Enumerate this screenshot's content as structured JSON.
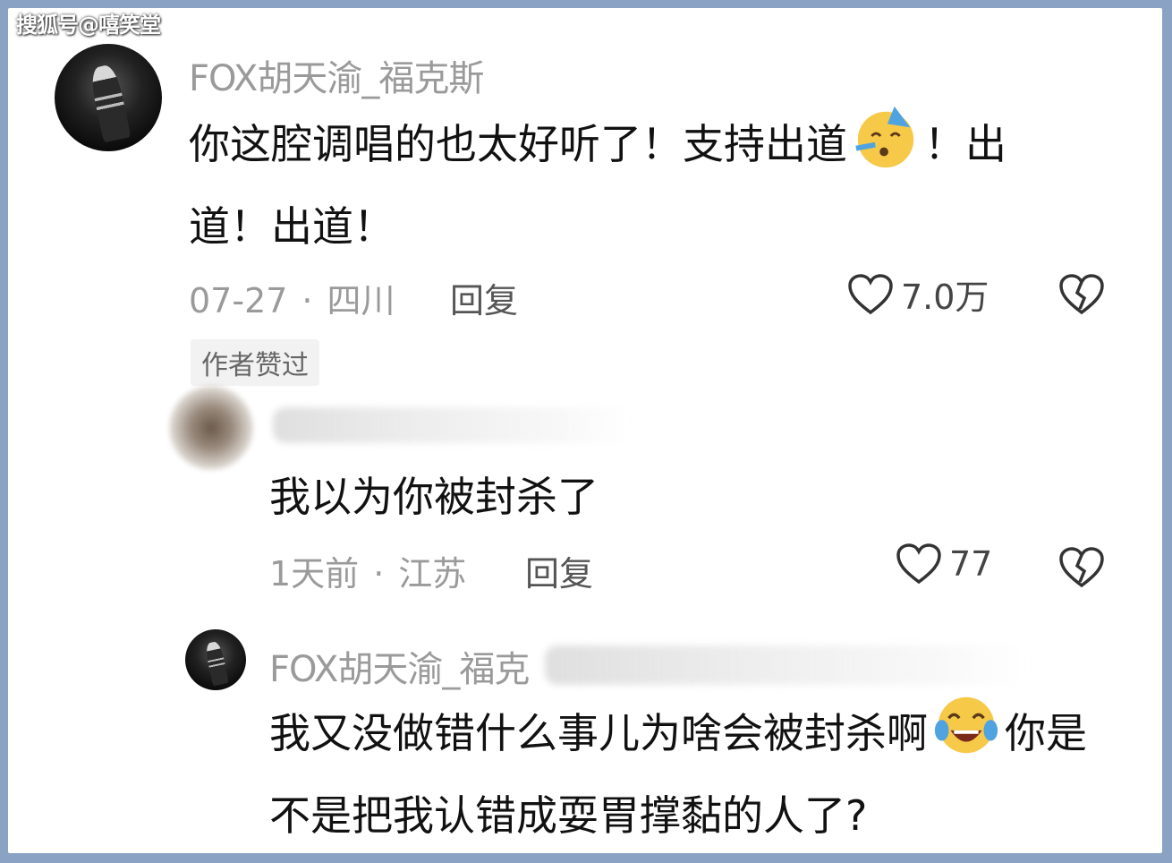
{
  "watermark": "搜狐号@嘻笑堂",
  "comments": [
    {
      "username": "FOX胡天渝_福克斯",
      "text_part1": "你这腔调唱的也太好听了！支持出道",
      "emoji": "party-face-icon",
      "text_part2": "！出道！出道！",
      "date": "07-27",
      "location": "四川",
      "reply_label": "回复",
      "likes": "7.0万",
      "badge": "作者赞过"
    },
    {
      "username": "",
      "text": "我以为你被封杀了",
      "date": "1天前",
      "location": "江苏",
      "reply_label": "回复",
      "likes": "77"
    },
    {
      "username": "FOX胡天渝_福克",
      "text_part1": "我又没做错什么事儿为啥会被封杀啊",
      "emoji": "tears-of-joy-icon",
      "text_part2": "你是不是把我认错成耍胃撑黏的人了?"
    }
  ],
  "colors": {
    "background_frame": "#8aa3c4",
    "muted_text": "#9a9a9a",
    "body_text": "#111111"
  }
}
